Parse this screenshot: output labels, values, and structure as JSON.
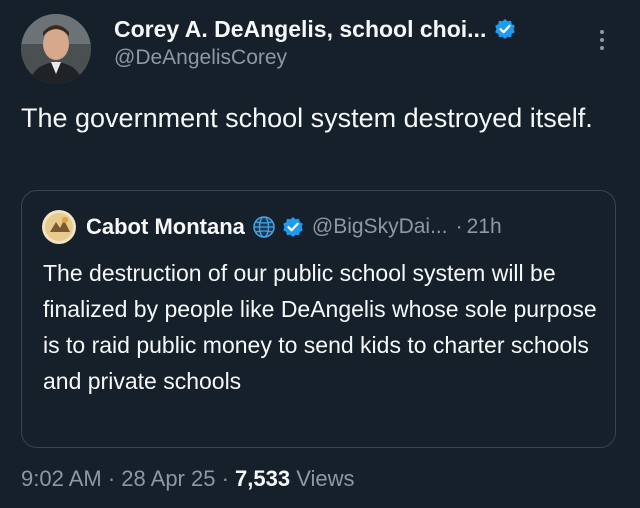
{
  "author": {
    "name": "Corey A. DeAngelis, school choi...",
    "handle": "@DeAngelisCorey"
  },
  "tweet": {
    "text": "The government school system destroyed itself."
  },
  "quote": {
    "name": "Cabot Montana",
    "handle": "@BigSkyDai...",
    "separator": "·",
    "time": "21h",
    "text": "The destruction of our public school system will be finalized by people like DeAngelis whose sole purpose is to raid public money to send kids to charter schools and private schools"
  },
  "meta": {
    "time": "9:02 AM",
    "sep1": " · ",
    "date": "28 Apr 25",
    "sep2": " · ",
    "views_count": "7,533",
    "views_label": " Views"
  },
  "icons": {
    "verified": "verified-badge-icon",
    "globe": "globe-icon",
    "more": "more-icon"
  },
  "colors": {
    "background": "#15202b",
    "text_primary": "#f7f9f9",
    "text_secondary": "#8b98a5",
    "verified_blue": "#1d9bf0",
    "border": "#38444d"
  }
}
